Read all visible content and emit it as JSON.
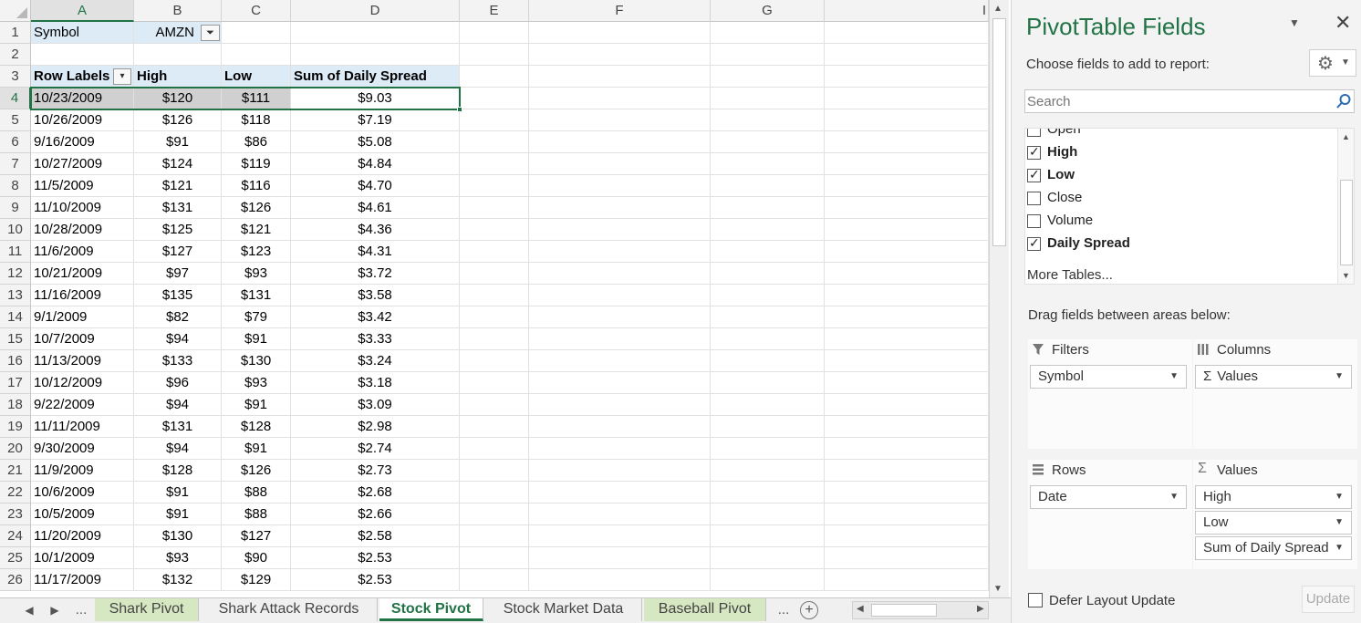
{
  "sheet": {
    "columns": [
      "A",
      "B",
      "C",
      "D",
      "E",
      "F",
      "G",
      "I"
    ],
    "filter_row": {
      "label": "Symbol",
      "value": "AMZN"
    },
    "headers": [
      "Row Labels",
      "High",
      "Low",
      "Sum of Daily Spread"
    ],
    "rows": [
      {
        "n": "4",
        "date": "10/23/2009",
        "high": "$120",
        "low": "$111",
        "spread": "$9.03"
      },
      {
        "n": "5",
        "date": "10/26/2009",
        "high": "$126",
        "low": "$118",
        "spread": "$7.19"
      },
      {
        "n": "6",
        "date": "9/16/2009",
        "high": "$91",
        "low": "$86",
        "spread": "$5.08"
      },
      {
        "n": "7",
        "date": "10/27/2009",
        "high": "$124",
        "low": "$119",
        "spread": "$4.84"
      },
      {
        "n": "8",
        "date": "11/5/2009",
        "high": "$121",
        "low": "$116",
        "spread": "$4.70"
      },
      {
        "n": "9",
        "date": "11/10/2009",
        "high": "$131",
        "low": "$126",
        "spread": "$4.61"
      },
      {
        "n": "10",
        "date": "10/28/2009",
        "high": "$125",
        "low": "$121",
        "spread": "$4.36"
      },
      {
        "n": "11",
        "date": "11/6/2009",
        "high": "$127",
        "low": "$123",
        "spread": "$4.31"
      },
      {
        "n": "12",
        "date": "10/21/2009",
        "high": "$97",
        "low": "$93",
        "spread": "$3.72"
      },
      {
        "n": "13",
        "date": "11/16/2009",
        "high": "$135",
        "low": "$131",
        "spread": "$3.58"
      },
      {
        "n": "14",
        "date": "9/1/2009",
        "high": "$82",
        "low": "$79",
        "spread": "$3.42"
      },
      {
        "n": "15",
        "date": "10/7/2009",
        "high": "$94",
        "low": "$91",
        "spread": "$3.33"
      },
      {
        "n": "16",
        "date": "11/13/2009",
        "high": "$133",
        "low": "$130",
        "spread": "$3.24"
      },
      {
        "n": "17",
        "date": "10/12/2009",
        "high": "$96",
        "low": "$93",
        "spread": "$3.18"
      },
      {
        "n": "18",
        "date": "9/22/2009",
        "high": "$94",
        "low": "$91",
        "spread": "$3.09"
      },
      {
        "n": "19",
        "date": "11/11/2009",
        "high": "$131",
        "low": "$128",
        "spread": "$2.98"
      },
      {
        "n": "20",
        "date": "9/30/2009",
        "high": "$94",
        "low": "$91",
        "spread": "$2.74"
      },
      {
        "n": "21",
        "date": "11/9/2009",
        "high": "$128",
        "low": "$126",
        "spread": "$2.73"
      },
      {
        "n": "22",
        "date": "10/6/2009",
        "high": "$91",
        "low": "$88",
        "spread": "$2.68"
      },
      {
        "n": "23",
        "date": "10/5/2009",
        "high": "$91",
        "low": "$88",
        "spread": "$2.66"
      },
      {
        "n": "24",
        "date": "11/20/2009",
        "high": "$130",
        "low": "$127",
        "spread": "$2.58"
      },
      {
        "n": "25",
        "date": "10/1/2009",
        "high": "$93",
        "low": "$90",
        "spread": "$2.53"
      },
      {
        "n": "26",
        "date": "11/17/2009",
        "high": "$132",
        "low": "$129",
        "spread": "$2.53"
      }
    ],
    "row_numbers": [
      "1",
      "2",
      "3"
    ]
  },
  "tabs": {
    "ellipsis_left": "...",
    "items": [
      "Shark Pivot",
      "Shark Attack Records",
      "Stock Pivot",
      "Stock Market Data",
      "Baseball Pivot"
    ],
    "ellipsis_right": "...",
    "add": "+"
  },
  "pane": {
    "title": "PivotTable Fields",
    "choose_label": "Choose fields to add to report:",
    "search_placeholder": "Search",
    "fields": [
      {
        "label": "Open",
        "checked": false
      },
      {
        "label": "High",
        "checked": true
      },
      {
        "label": "Low",
        "checked": true
      },
      {
        "label": "Close",
        "checked": false
      },
      {
        "label": "Volume",
        "checked": false
      },
      {
        "label": "Daily Spread",
        "checked": true
      }
    ],
    "more_tables": "More Tables...",
    "drag_label": "Drag fields between areas below:",
    "filters_title": "Filters",
    "columns_title": "Columns",
    "rows_title": "Rows",
    "values_title": "Values",
    "filters_items": [
      "Symbol"
    ],
    "columns_items": [
      "Values"
    ],
    "rows_items": [
      "Date"
    ],
    "values_items": [
      "High",
      "Low",
      "Sum of Daily Spread"
    ],
    "defer_label": "Defer Layout Update",
    "update_label": "Update"
  }
}
